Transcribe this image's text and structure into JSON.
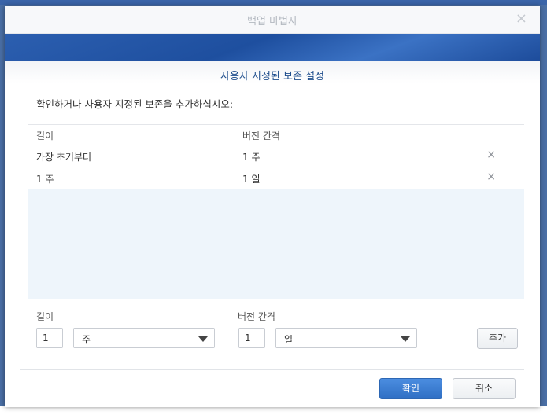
{
  "window": {
    "title": "백업 마법사",
    "close_icon": "×"
  },
  "section_title": "사용자 지정된 보존 설정",
  "description": "확인하거나 사용자 지정된 보존을 추가하십시오:",
  "table": {
    "columns": [
      "길이",
      "버전 간격"
    ],
    "rows": [
      {
        "length": "가장 초기부터",
        "interval": "1 주",
        "delete_icon": "×"
      },
      {
        "length": "1 주",
        "interval": "1 일",
        "delete_icon": "×"
      }
    ]
  },
  "form": {
    "length_label": "길이",
    "length_value": "1",
    "length_unit": "주",
    "interval_label": "버전 간격",
    "interval_value": "1",
    "interval_unit": "일",
    "add_label": "추가"
  },
  "footer": {
    "ok_label": "확인",
    "cancel_label": "취소"
  },
  "colors": {
    "primary": "#2f6fc4",
    "banner": "#1e4f9f",
    "title_text": "#1f4e8d"
  }
}
